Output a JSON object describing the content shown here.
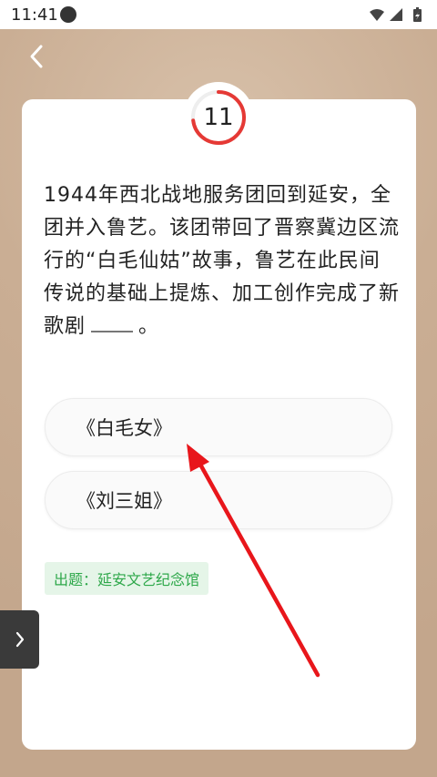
{
  "status_bar": {
    "time": "11:41",
    "icons": [
      "wifi-icon",
      "signal-icon",
      "battery-icon"
    ]
  },
  "header": {
    "back_icon": "chevron-left-icon"
  },
  "quiz": {
    "timer_value": "11",
    "timer_remaining_fraction": 0.73,
    "question_before_blank": "1944年西北战地服务团回到延安，全团并入鲁艺。该团带回了晋察冀边区流行的“白毛仙姑”故事，鲁艺在此民间传说的基础上提炼、加工创作完成了新歌剧",
    "question_after_blank": "。",
    "options": [
      {
        "label": "《白毛女》"
      },
      {
        "label": "《刘三姐》"
      }
    ],
    "source_label": "出题：延安文艺纪念馆"
  },
  "side_panel": {
    "icon": "chevron-right-icon"
  },
  "colors": {
    "timer_ring": "#e53935",
    "annotation_arrow": "#e8161b",
    "source_tag_text": "#2ea84a"
  }
}
